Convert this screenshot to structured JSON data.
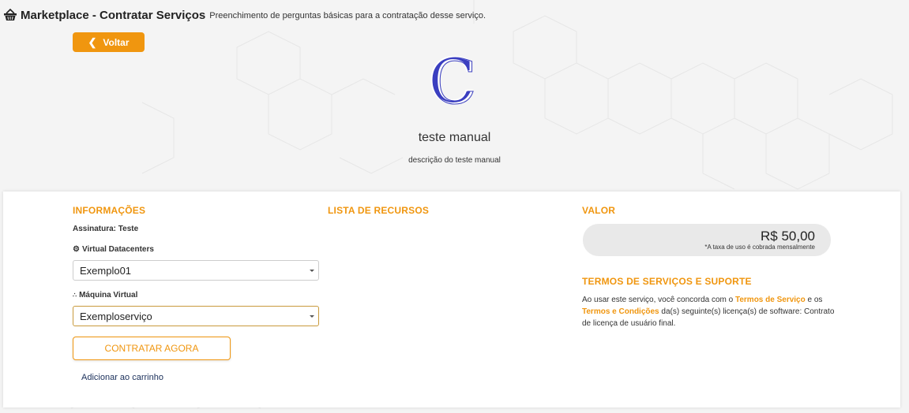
{
  "header": {
    "title": "Marketplace - Contratar Serviços",
    "subtitle": "Preenchimento de perguntas básicas para a contratação desse serviço."
  },
  "back_button": {
    "label": "Voltar",
    "icon": "chevron-left-icon"
  },
  "service": {
    "logo_letter": "C",
    "name": "teste manual",
    "description": "descrição do teste manual"
  },
  "info": {
    "title": "INFORMAÇÕES",
    "subscription": "Assinatura: Teste",
    "datacenter_label": "Virtual Datacenters",
    "datacenter_value": "Exemplo01",
    "vm_label": "Máquina Virtual",
    "vm_value": "Exemploserviço",
    "contratar_label": "CONTRATAR AGORA",
    "cart_label": "Adicionar ao carrinho"
  },
  "resources": {
    "title": "LISTA DE RECURSOS"
  },
  "value": {
    "title": "VALOR",
    "price": "R$ 50,00",
    "note": "*A taxa de uso é cobrada mensalmente"
  },
  "terms": {
    "title": "TERMOS DE SERVIÇOS E SUPORTE",
    "text_1": "Ao usar este serviço, você concorda com o ",
    "link_1": "Termos de Serviço",
    "text_2": " e os ",
    "link_2": "Termos e Condições",
    "text_3": " da(s) seguinte(s) licença(s) de software: Contrato de licença de usuário final."
  },
  "colors": {
    "accent": "#f0960f",
    "logo": "#3b3fc0",
    "link_dark": "#1a2f5a"
  }
}
